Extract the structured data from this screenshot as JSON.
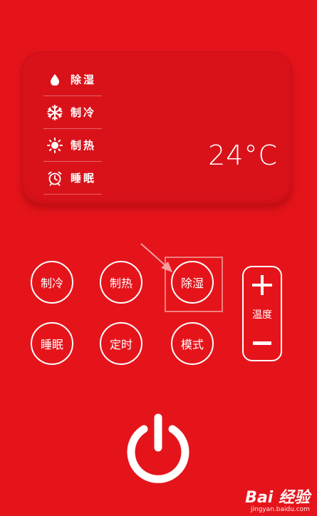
{
  "display": {
    "modes": [
      {
        "icon": "water-drop-icon",
        "label": "除湿"
      },
      {
        "icon": "snowflake-icon",
        "label": "制冷"
      },
      {
        "icon": "sun-icon",
        "label": "制热"
      },
      {
        "icon": "alarm-clock-icon",
        "label": "睡眠"
      }
    ],
    "temperature": "24°C"
  },
  "buttons": {
    "cool": "制冷",
    "heat": "制热",
    "dehumidify": "除湿",
    "sleep": "睡眠",
    "timer": "定时",
    "mode": "模式"
  },
  "temp_control": {
    "label": "温度",
    "increase_icon": "plus-icon",
    "decrease_icon": "minus-icon"
  },
  "power": {
    "icon": "power-icon"
  },
  "watermark": {
    "brand": "Bai 经验",
    "url": "jingyan.baidu.com"
  },
  "colors": {
    "background": "#e5141b",
    "panel": "#d9121a",
    "foreground": "#ffffff",
    "highlight": "#f08080"
  }
}
